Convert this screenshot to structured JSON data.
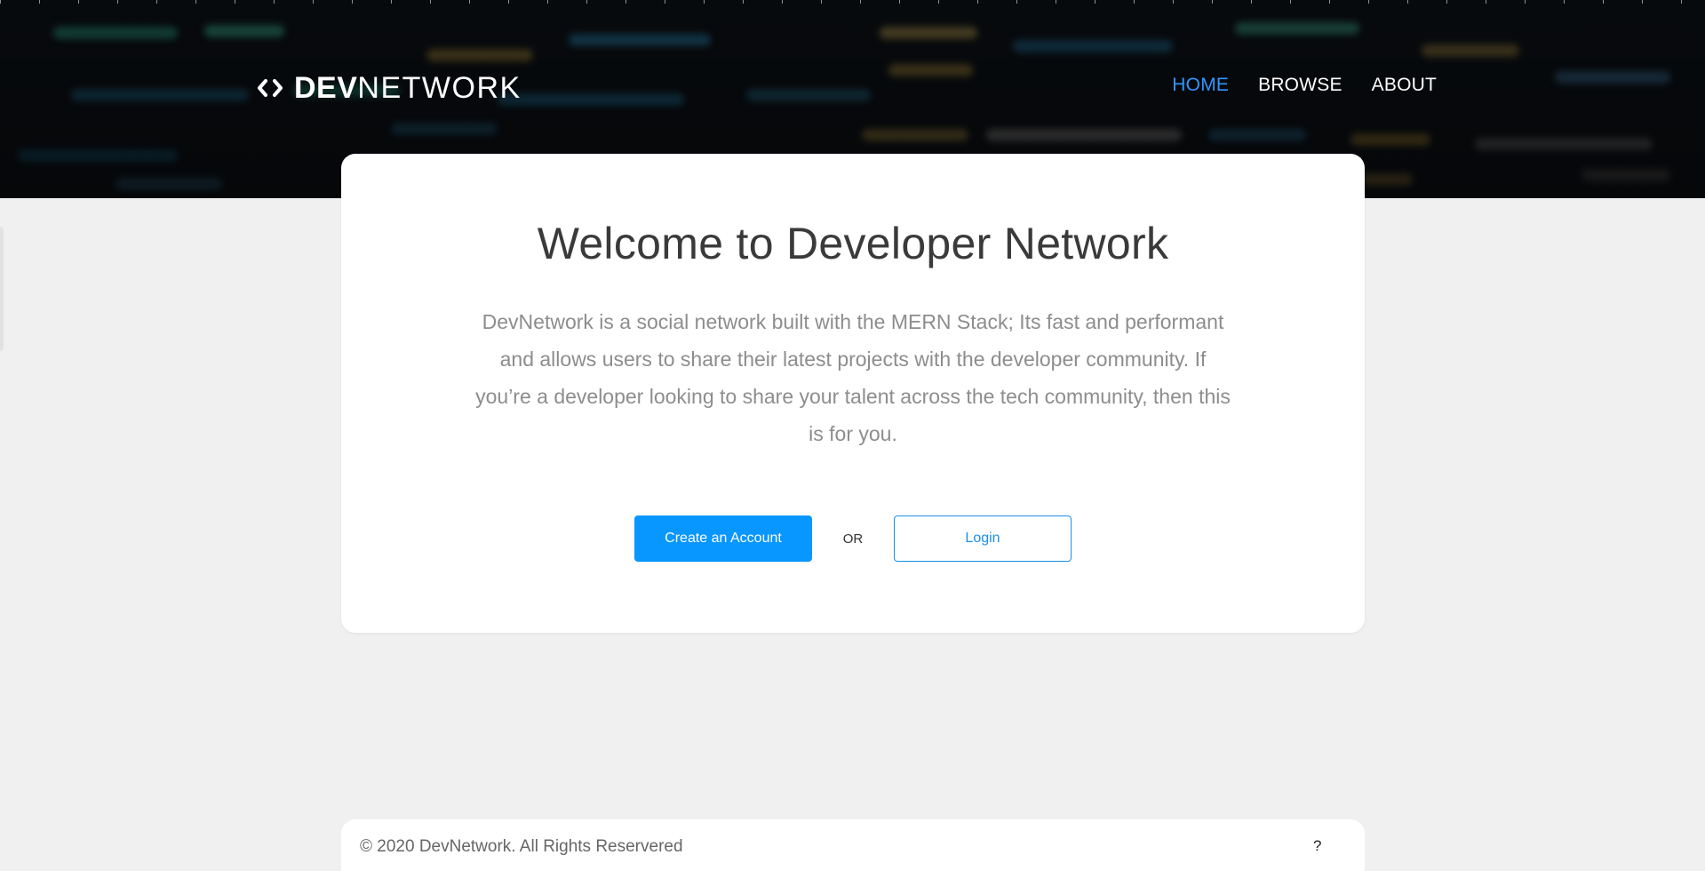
{
  "header": {
    "brand_strong": "DEV",
    "brand_light": "NETWORK",
    "brand_icon": "code-brackets-icon",
    "nav": [
      {
        "label": "HOME",
        "active": true
      },
      {
        "label": "BROWSE",
        "active": false
      },
      {
        "label": "ABOUT",
        "active": false
      }
    ],
    "active_color": "#2f96ff"
  },
  "main": {
    "title": "Welcome to Developer Network",
    "description": "DevNetwork is a social network built with the MERN Stack; Its fast and performant and allows users to share their latest projects with the developer community. If you’re a developer looking to share your talent across the tech community, then this is for you.",
    "create_label": "Create an Account",
    "or_label": "OR",
    "login_label": "Login",
    "primary_color": "#0896ff"
  },
  "footer": {
    "copyright": "© 2020 DevNetwork. All Rights Reservered",
    "help": "?"
  }
}
